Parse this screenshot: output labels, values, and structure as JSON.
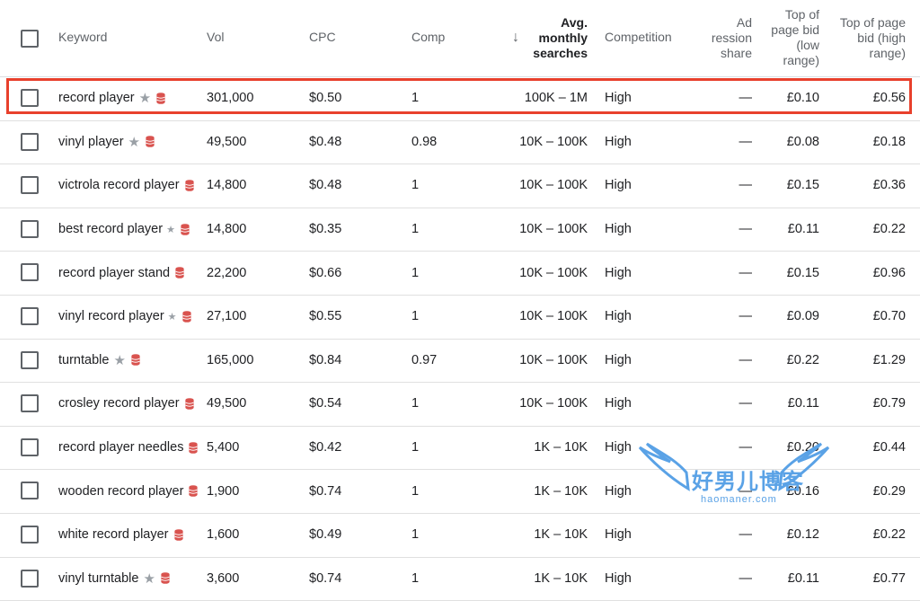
{
  "headers": {
    "keyword": "Keyword",
    "vol": "Vol",
    "cpc": "CPC",
    "comp": "Comp",
    "sort_arrow": "↓",
    "avg_line1": "Avg.",
    "avg_line2": "monthly",
    "avg_line3": "searches",
    "competition": "Competition",
    "ad_line1": "Ad",
    "ad_line2": "ression",
    "ad_line3": "share",
    "low_line1": "Top of",
    "low_line2": "page bid",
    "low_line3": "(low",
    "low_line4": "range)",
    "high_line1": "Top of page",
    "high_line2": "bid (high",
    "high_line3": "range)"
  },
  "rows": [
    {
      "keyword": "record player",
      "star": "large",
      "vol": "301,000",
      "cpc": "$0.50",
      "comp": "1",
      "avg": "100K – 1M",
      "competition": "High",
      "share": "—",
      "low": "£0.10",
      "high": "£0.56"
    },
    {
      "keyword": "vinyl player",
      "star": "large",
      "vol": "49,500",
      "cpc": "$0.48",
      "comp": "0.98",
      "avg": "10K – 100K",
      "competition": "High",
      "share": "—",
      "low": "£0.08",
      "high": "£0.18"
    },
    {
      "keyword": "victrola record player",
      "star": "none",
      "vol": "14,800",
      "cpc": "$0.48",
      "comp": "1",
      "avg": "10K – 100K",
      "competition": "High",
      "share": "—",
      "low": "£0.15",
      "high": "£0.36"
    },
    {
      "keyword": "best record player",
      "star": "small",
      "vol": "14,800",
      "cpc": "$0.35",
      "comp": "1",
      "avg": "10K – 100K",
      "competition": "High",
      "share": "—",
      "low": "£0.11",
      "high": "£0.22"
    },
    {
      "keyword": "record player stand",
      "star": "none",
      "vol": "22,200",
      "cpc": "$0.66",
      "comp": "1",
      "avg": "10K – 100K",
      "competition": "High",
      "share": "—",
      "low": "£0.15",
      "high": "£0.96"
    },
    {
      "keyword": "vinyl record player",
      "star": "small",
      "vol": "27,100",
      "cpc": "$0.55",
      "comp": "1",
      "avg": "10K – 100K",
      "competition": "High",
      "share": "—",
      "low": "£0.09",
      "high": "£0.70"
    },
    {
      "keyword": "turntable",
      "star": "large",
      "vol": "165,000",
      "cpc": "$0.84",
      "comp": "0.97",
      "avg": "10K – 100K",
      "competition": "High",
      "share": "—",
      "low": "£0.22",
      "high": "£1.29"
    },
    {
      "keyword": "crosley record player",
      "star": "none",
      "vol": "49,500",
      "cpc": "$0.54",
      "comp": "1",
      "avg": "10K – 100K",
      "competition": "High",
      "share": "—",
      "low": "£0.11",
      "high": "£0.79"
    },
    {
      "keyword": "record player needles",
      "star": "none",
      "vol": "5,400",
      "cpc": "$0.42",
      "comp": "1",
      "avg": "1K – 10K",
      "competition": "High",
      "share": "—",
      "low": "£0.20",
      "high": "£0.44"
    },
    {
      "keyword": "wooden record player",
      "star": "none",
      "vol": "1,900",
      "cpc": "$0.74",
      "comp": "1",
      "avg": "1K – 10K",
      "competition": "High",
      "share": "—",
      "low": "£0.16",
      "high": "£0.29"
    },
    {
      "keyword": "white record player",
      "star": "none",
      "vol": "1,600",
      "cpc": "$0.49",
      "comp": "1",
      "avg": "1K – 10K",
      "competition": "High",
      "share": "—",
      "low": "£0.12",
      "high": "£0.22"
    },
    {
      "keyword": "vinyl turntable",
      "star": "large",
      "vol": "3,600",
      "cpc": "$0.74",
      "comp": "1",
      "avg": "1K – 10K",
      "competition": "High",
      "share": "—",
      "low": "£0.11",
      "high": "£0.77"
    }
  ],
  "watermark": {
    "text": "好男儿博客",
    "sub": "haomaner.com"
  },
  "colors": {
    "highlight": "#e8402c",
    "db_icon": "#d9534f",
    "star": "#9aa0a6",
    "watermark": "#5aa2e6"
  }
}
